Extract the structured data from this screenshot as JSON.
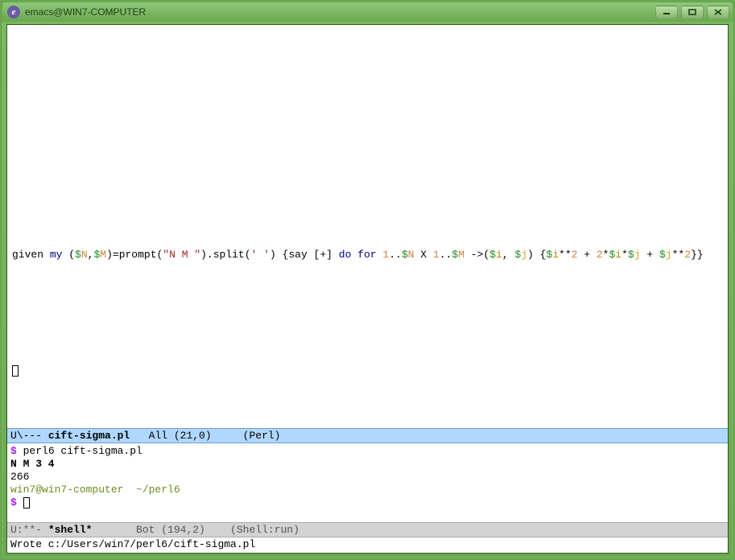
{
  "window": {
    "title": "emacs@WIN7-COMPUTER"
  },
  "editor": {
    "code": {
      "t1": "given ",
      "kw_my": "my",
      "t2": " (",
      "d1": "$",
      "vN1": "N",
      "t3": ",",
      "d2": "$",
      "vM1": "M",
      "t4": ")=prompt(",
      "str1": "\"N M \"",
      "t5": ").split(",
      "str2": "' '",
      "t6": ") {say [+] ",
      "kw_do": "do",
      "t7": " ",
      "kw_for": "for",
      "t8": " ",
      "n1": "1",
      "t9": "..",
      "d3": "$",
      "vN2": "N",
      "t10": " X ",
      "n2": "1",
      "t11": "..",
      "d4": "$",
      "vM2": "M",
      "t12": " ->(",
      "d5": "$",
      "vI1": "i",
      "t13": ", ",
      "d6": "$",
      "vJ1": "j",
      "t14": ") {",
      "d7": "$",
      "vI2": "i",
      "t15": "**",
      "n3": "2",
      "t16": " + ",
      "n4": "2",
      "t17": "*",
      "d8": "$",
      "vI3": "i",
      "t18": "*",
      "d9": "$",
      "vJ2": "j",
      "t19": " + ",
      "d10": "$",
      "vJ3": "j",
      "t20": "**",
      "n5": "2",
      "t21": "}}"
    }
  },
  "modeline_top": {
    "left": "U\\--- ",
    "filename": "cift-sigma.pl",
    "mid": "   All (21,0)     ",
    "mode": "(Perl)"
  },
  "shell": {
    "prompt1_sym": "$",
    "cmd1": " perl6 cift-sigma.pl",
    "io_line": "N M 3 4",
    "output": "266",
    "cwd": "win7@win7-computer  ~/perl6",
    "prompt2_sym": "$"
  },
  "modeline_bot": {
    "left": "U:**- ",
    "buffer": "*shell*",
    "mid": "       Bot (194,2)    ",
    "mode": "(Shell:run)"
  },
  "minibuffer": {
    "text": "Wrote c:/Users/win7/perl6/cift-sigma.pl"
  }
}
